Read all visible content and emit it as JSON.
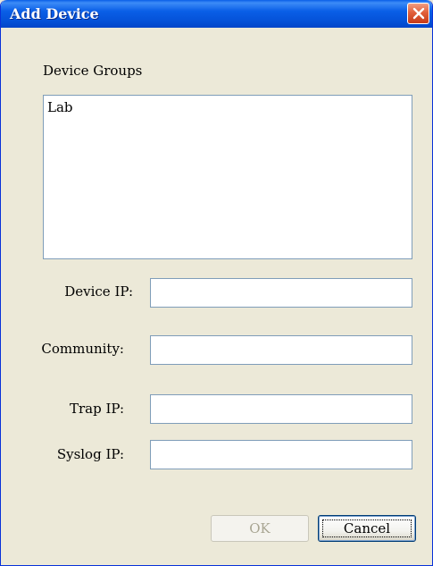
{
  "window": {
    "title": "Add Device"
  },
  "device_groups": {
    "label": "Device Groups",
    "items": [
      "Lab"
    ]
  },
  "form": {
    "device_ip": {
      "label": "Device IP:",
      "value": ""
    },
    "community": {
      "label": "Community:",
      "value": ""
    },
    "trap_ip": {
      "label": "Trap IP:",
      "value": ""
    },
    "syslog_ip": {
      "label": "Syslog IP:",
      "value": ""
    }
  },
  "buttons": {
    "ok": "OK",
    "cancel": "Cancel"
  },
  "icons": {
    "close": "close-icon"
  },
  "colors": {
    "titlebar": "#0a5fe7",
    "close_button": "#e1603c",
    "window_bg": "#ece9d8",
    "disabled_text": "#a8a592"
  }
}
